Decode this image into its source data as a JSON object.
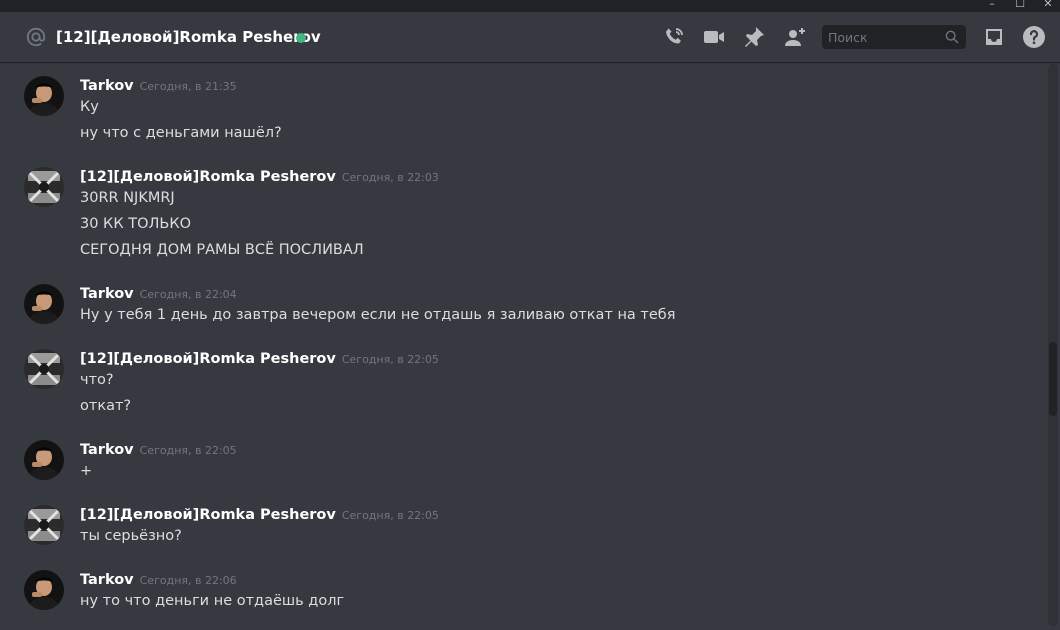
{
  "header": {
    "title": "[12][Деловой]Romka Pesherov",
    "status": "online",
    "icons": [
      "call-icon",
      "video-icon",
      "pin-icon",
      "add-member-icon",
      "inbox-icon",
      "help-icon"
    ],
    "search_placeholder": "Поиск"
  },
  "colors": {
    "background": "#36393f",
    "online": "#43b581",
    "titlebar": "#202225"
  },
  "messages": [
    {
      "author": "Tarkov",
      "time": "Сегодня, в 21:35",
      "lines": [
        "Ку",
        "ну что с деньгами нашёл?"
      ],
      "avatar": "tarkov"
    },
    {
      "author": "[12][Деловой]Romka Pesherov",
      "time": "Сегодня, в 22:03",
      "lines": [
        "30RR NJKMRJ",
        "30 КК ТОЛЬКО",
        "СЕГОДНЯ ДОМ РАМЫ ВСЁ ПОСЛИВАЛ"
      ],
      "avatar": "romka"
    },
    {
      "author": "Tarkov",
      "time": "Сегодня, в 22:04",
      "lines": [
        "Ну у тебя 1 день до завтра вечером если не отдашь я заливаю откат на тебя"
      ],
      "avatar": "tarkov"
    },
    {
      "author": "[12][Деловой]Romka Pesherov",
      "time": "Сегодня, в 22:05",
      "lines": [
        "что?",
        "откат?"
      ],
      "avatar": "romka"
    },
    {
      "author": "Tarkov",
      "time": "Сегодня, в 22:05",
      "lines": [
        "+"
      ],
      "avatar": "tarkov"
    },
    {
      "author": "[12][Деловой]Romka Pesherov",
      "time": "Сегодня, в 22:05",
      "lines": [
        "ты серьёзно?"
      ],
      "avatar": "romka"
    },
    {
      "author": "Tarkov",
      "time": "Сегодня, в 22:06",
      "lines": [
        "ну то что деньги не отдаёшь долг"
      ],
      "avatar": "tarkov"
    }
  ]
}
